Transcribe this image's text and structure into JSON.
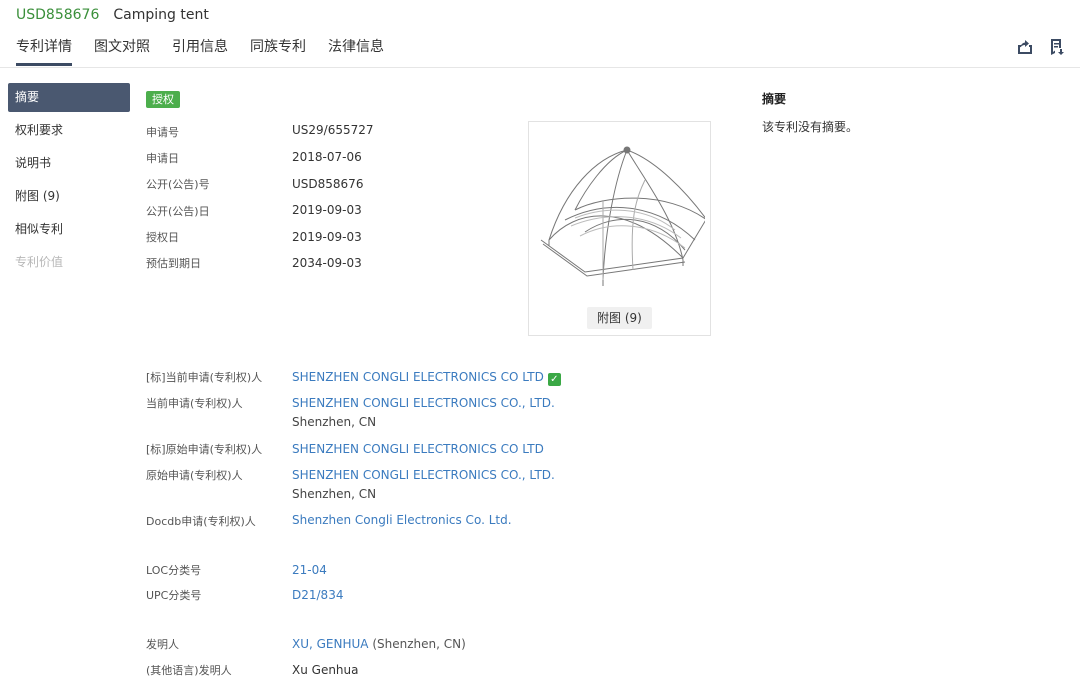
{
  "header": {
    "pub_no": "USD858676",
    "title": "Camping tent"
  },
  "tabs": [
    {
      "label": "专利详情"
    },
    {
      "label": "图文对照"
    },
    {
      "label": "引用信息"
    },
    {
      "label": "同族专利"
    },
    {
      "label": "法律信息"
    }
  ],
  "tool_icons": [
    "share-icon",
    "bookmark-download-icon"
  ],
  "sidebar": {
    "items": [
      {
        "label": "摘要"
      },
      {
        "label": "权利要求"
      },
      {
        "label": "说明书"
      },
      {
        "label": "附图 (9)"
      },
      {
        "label": "相似专利"
      },
      {
        "label": "专利价值"
      }
    ]
  },
  "status": {
    "badge": "授权",
    "badge_color": "#4cae4c"
  },
  "basic": [
    {
      "label": "申请号",
      "value": "US29/655727"
    },
    {
      "label": "申请日",
      "value": "2018-07-06"
    },
    {
      "label": "公开(公告)号",
      "value": "USD858676"
    },
    {
      "label": "公开(公告)日",
      "value": "2019-09-03"
    },
    {
      "label": "授权日",
      "value": "2019-09-03"
    },
    {
      "label": "预估到期日",
      "value": "2034-09-03"
    }
  ],
  "figure": {
    "button": "附图 (9)"
  },
  "parties": [
    {
      "label": "[标]当前申请(专利权)人",
      "value": "SHENZHEN CONGLI ELECTRONICS CO LTD"
    },
    {
      "label": "当前申请(专利权)人",
      "value": "SHENZHEN CONGLI ELECTRONICS CO., LTD.",
      "sub": "Shenzhen, CN"
    },
    {
      "label": "[标]原始申请(专利权)人",
      "value": "SHENZHEN CONGLI ELECTRONICS CO LTD"
    },
    {
      "label": "原始申请(专利权)人",
      "value": "SHENZHEN CONGLI ELECTRONICS CO., LTD.",
      "sub": "Shenzhen, CN"
    },
    {
      "label": "Docdb申请(专利权)人",
      "value": "Shenzhen Congli Electronics Co. Ltd."
    }
  ],
  "classes": [
    {
      "label": "LOC分类号",
      "value": "21-04"
    },
    {
      "label": "UPC分类号",
      "value": "D21/834"
    }
  ],
  "inventors": [
    {
      "label": "发明人",
      "value": "XU, GENHUA",
      "sub": "(Shenzhen, CN)"
    },
    {
      "label": "(其他语言)发明人",
      "value": "Xu Genhua"
    }
  ],
  "abstract": {
    "title": "摘要",
    "text": "该专利没有摘要。"
  }
}
